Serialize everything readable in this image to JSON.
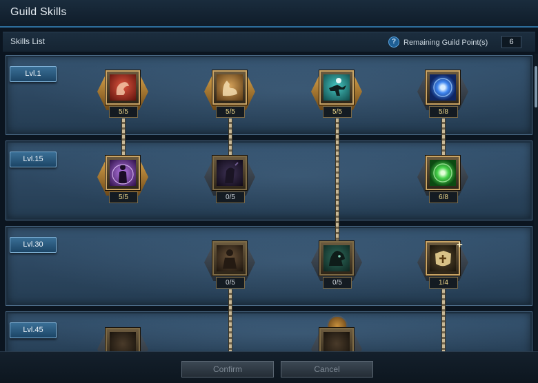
{
  "window": {
    "title": "Guild Skills"
  },
  "header": {
    "section_label": "Skills List",
    "help_icon": "?",
    "remaining_points_label": "Remaining Guild Point(s)",
    "remaining_points_value": "6"
  },
  "tiers": [
    {
      "label": "Lvl.1"
    },
    {
      "label": "Lvl.15"
    },
    {
      "label": "Lvl.30"
    },
    {
      "label": "Lvl.45"
    }
  ],
  "skills": [
    {
      "name": "strength-arm",
      "icon": "flexed-arm-icon",
      "count": "5/5",
      "color": "#c0392b"
    },
    {
      "name": "bulk-up",
      "icon": "muscle-icon",
      "count": "5/5",
      "color": "#c98a3a"
    },
    {
      "name": "sprint",
      "icon": "running-figure-icon",
      "count": "5/5",
      "color": "#2f9a9a"
    },
    {
      "name": "orb",
      "icon": "blue-orb-icon",
      "count": "5/8",
      "color": "#2b64d6"
    },
    {
      "name": "aura",
      "icon": "purple-aura-icon",
      "count": "5/5",
      "color": "#8a3fc0"
    },
    {
      "name": "shadow",
      "icon": "shadow-figure-icon",
      "count": "0/5",
      "color": "#4a3a6a"
    },
    {
      "name": "green-orb",
      "icon": "green-orb-icon",
      "count": "6/8",
      "color": "#2e9a3a"
    },
    {
      "name": "warrior",
      "icon": "warrior-icon",
      "count": "0/5",
      "color": "#6a5238"
    },
    {
      "name": "beast",
      "icon": "beast-head-icon",
      "count": "0/5",
      "color": "#2e6a5a"
    },
    {
      "name": "guild-shield",
      "icon": "shield-icon",
      "count": "1/4",
      "color": "#d8c48a"
    }
  ],
  "footer": {
    "confirm_label": "Confirm",
    "cancel_label": "Cancel"
  }
}
